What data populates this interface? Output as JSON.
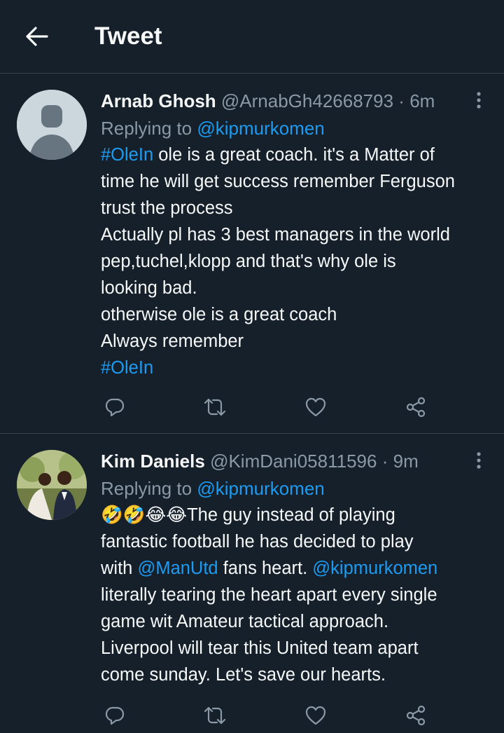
{
  "header": {
    "title": "Tweet"
  },
  "colors": {
    "background": "#15202b",
    "link": "#1d9bf0",
    "muted": "#8b98a5",
    "divider": "#38444d"
  },
  "tweets": [
    {
      "name": "Arnab Ghosh",
      "handle": "@ArnabGh42668793",
      "dot": "·",
      "time": "6m",
      "replying_prefix": "Replying to ",
      "replying_handle": "@kipmurkomen",
      "lines": [
        {
          "hashtag": "#OleIn",
          "text": " ole is a great coach. it's  a Matter of"
        },
        {
          "text": "time he will get success remember Ferguson"
        },
        {
          "text": "trust the process"
        },
        {
          "text": "Actually pl has 3 best managers in the world"
        },
        {
          "text": "pep,tuchel,klopp and that's  why ole is"
        },
        {
          "text": "looking bad."
        },
        {
          "text": "otherwise ole is a great coach"
        },
        {
          "text": "Always remember"
        },
        {
          "hashtag": "#OleIn"
        }
      ],
      "icons": [
        "reply-icon",
        "retweet-icon",
        "like-icon",
        "share-icon",
        "more-icon"
      ]
    },
    {
      "name": "Kim Daniels",
      "handle": "@KimDani05811596",
      "dot": "·",
      "time": "9m",
      "replying_prefix": "Replying to ",
      "replying_handle": "@kipmurkomen",
      "lines": {
        "l1_emoji": "🤣🤣😂😂",
        "l1_text": "The guy instead of playing",
        "l2": "fantastic football he has decided to play",
        "l3_a": "with ",
        "l3_mention1": "@ManUtd",
        "l3_b": " fans heart. ",
        "l3_mention2": "@kipmurkomen",
        "l4": "literally tearing the heart apart every single",
        "l5": "game wit Amateur tactical approach.",
        "l6": "Liverpool will tear this United team apart",
        "l7": "come sunday. Let's save our hearts."
      },
      "icons": [
        "reply-icon",
        "retweet-icon",
        "like-icon",
        "share-icon",
        "more-icon"
      ]
    }
  ]
}
